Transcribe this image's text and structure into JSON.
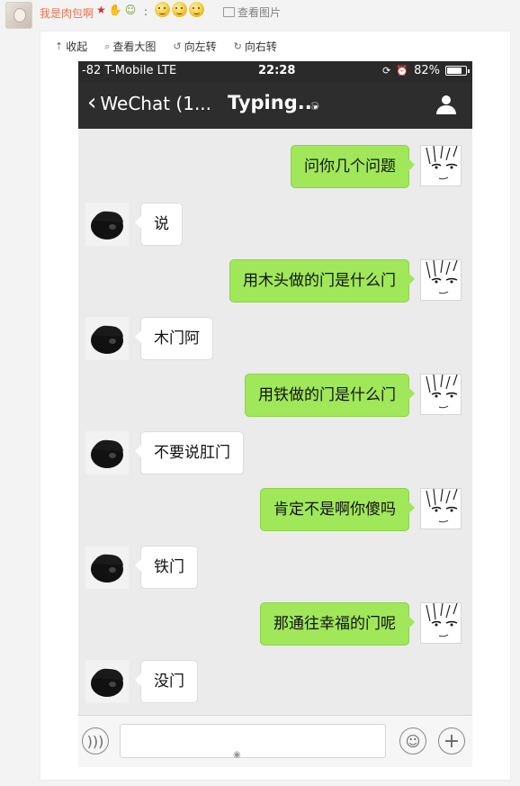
{
  "weibo": {
    "username": "我是肉包啊",
    "colon": ":",
    "view_image": "查看图片",
    "toolbar": {
      "collapse": "收起",
      "view_large": "查看大图",
      "rotate_left": "向左转",
      "rotate_right": "向右转"
    }
  },
  "status_bar": {
    "carrier": "-82 T-Mobile  LTE",
    "time": "22:28",
    "battery": "82%",
    "battery_level": 0.82
  },
  "nav": {
    "back_label": "WeChat (1...",
    "title": "Typing..."
  },
  "messages": [
    {
      "side": "right",
      "text": "问你几个问题"
    },
    {
      "side": "left",
      "text": "说"
    },
    {
      "side": "right",
      "text": "用木头做的门是什么门"
    },
    {
      "side": "left",
      "text": "木门阿"
    },
    {
      "side": "right",
      "text": "用铁做的门是什么门"
    },
    {
      "side": "left",
      "text": "不要说肛门"
    },
    {
      "side": "right",
      "text": "肯定不是啊你傻吗"
    },
    {
      "side": "left",
      "text": "铁门"
    },
    {
      "side": "right",
      "text": "那通往幸福的门呢"
    },
    {
      "side": "left",
      "text": "没门"
    }
  ],
  "colors": {
    "sent_bubble": "#a0e75a",
    "received_bubble": "#ffffff",
    "nav_bg": "#2d2d2d",
    "username": "#eb7350"
  },
  "icons": {
    "back": "chevron-left-icon",
    "contact": "person-icon",
    "voice": "voice-icon",
    "emoji": "emoji-icon",
    "plus": "plus-icon"
  }
}
